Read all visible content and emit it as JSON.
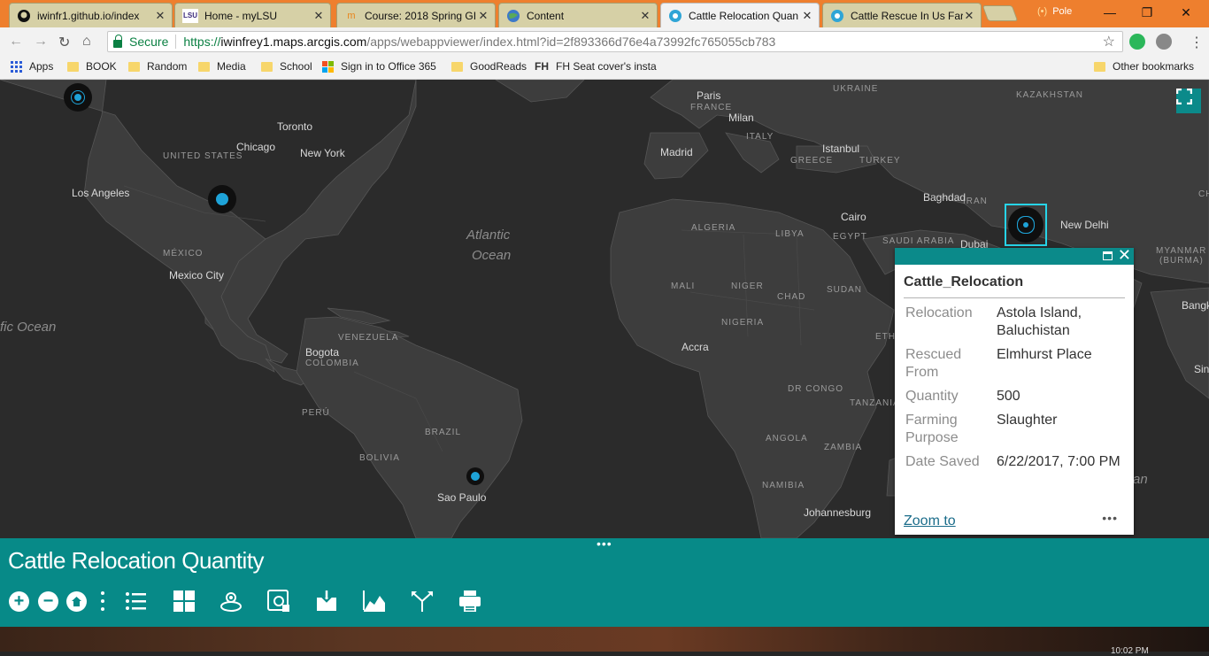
{
  "browser": {
    "tabs": [
      {
        "title": "iwinfr1.github.io/index",
        "icon": "github-icon"
      },
      {
        "title": "Home - myLSU",
        "icon": "lsu-icon"
      },
      {
        "title": "Course: 2018 Spring GI",
        "icon": "moodle-icon"
      },
      {
        "title": "Content",
        "icon": "globe-icon"
      },
      {
        "title": "Cattle Relocation Quan",
        "icon": "arcgis-icon",
        "active": true
      },
      {
        "title": "Cattle Rescue In Us Far",
        "icon": "arcgis-icon"
      }
    ],
    "profile_name": "Pole",
    "secure_label": "Secure",
    "url_proto": "https://",
    "url_host": "iwinfrey1.maps.arcgis.com",
    "url_path": "/apps/webappviewer/index.html?id=2f893366d76e4a73992fc765055cb783",
    "bookmarks": [
      "Apps",
      "BOOK",
      "Random",
      "Media",
      "School",
      "Sign in to Office 365",
      "GoodReads",
      "FH Seat cover's insta",
      "Other bookmarks"
    ]
  },
  "map": {
    "cities": [
      "Paris",
      "Milan",
      "Madrid",
      "Istanbul",
      "Baghdad",
      "Cairo",
      "Dubai",
      "New Delhi",
      "Toronto",
      "Chicago",
      "New York",
      "Los Angeles",
      "Mexico City",
      "Bogota",
      "Sao Paulo",
      "Accra",
      "Johannesburg",
      "Bangk",
      "Sin"
    ],
    "countries": [
      "UKRAINE",
      "KAZAKHSTAN",
      "FRANCE",
      "ITALY",
      "GREECE",
      "TURKEY",
      "IRAN",
      "ALGERIA",
      "LIBYA",
      "EGYPT",
      "SAUDI ARABIA",
      "MALI",
      "NIGER",
      "CHAD",
      "SUDAN",
      "NIGERIA",
      "ETHI",
      "DR CONGO",
      "TANZANIA",
      "ANGOLA",
      "ZAMBIA",
      "NAMIBIA",
      "UNITED STATES",
      "MÉXICO",
      "VENEZUELA",
      "COLOMBIA",
      "PERÚ",
      "BRAZIL",
      "BOLIVIA",
      "MYANMAR",
      "(BURMA)",
      "CH"
    ],
    "oceans": [
      "Atlantic",
      "Ocean",
      "fic Ocean",
      "an"
    ]
  },
  "popup": {
    "title": "Cattle_Relocation",
    "fields": [
      {
        "label": "Relocation",
        "value": "Astola Island, Baluchistan"
      },
      {
        "label": "Rescued From",
        "value": "Elmhurst Place"
      },
      {
        "label": "Quantity",
        "value": "500"
      },
      {
        "label": "Farming Purpose",
        "value": "Slaughter"
      },
      {
        "label": "Date Saved",
        "value": "6/22/2017, 7:00 PM"
      }
    ],
    "zoom_label": "Zoom to",
    "more_label": "•••"
  },
  "panel": {
    "title": "Cattle Relocation Quantity",
    "tools": [
      "zoom-in",
      "zoom-out",
      "home",
      "more",
      "layer-list",
      "basemap-gallery",
      "my-location",
      "attribute-table",
      "add-data",
      "elevation-profile",
      "directions",
      "print"
    ]
  },
  "colors": {
    "accent": "#078a88",
    "marker": "#1ea3d8",
    "selection": "#27d4e8"
  },
  "taskbar": {
    "clock": "10:02 PM"
  }
}
